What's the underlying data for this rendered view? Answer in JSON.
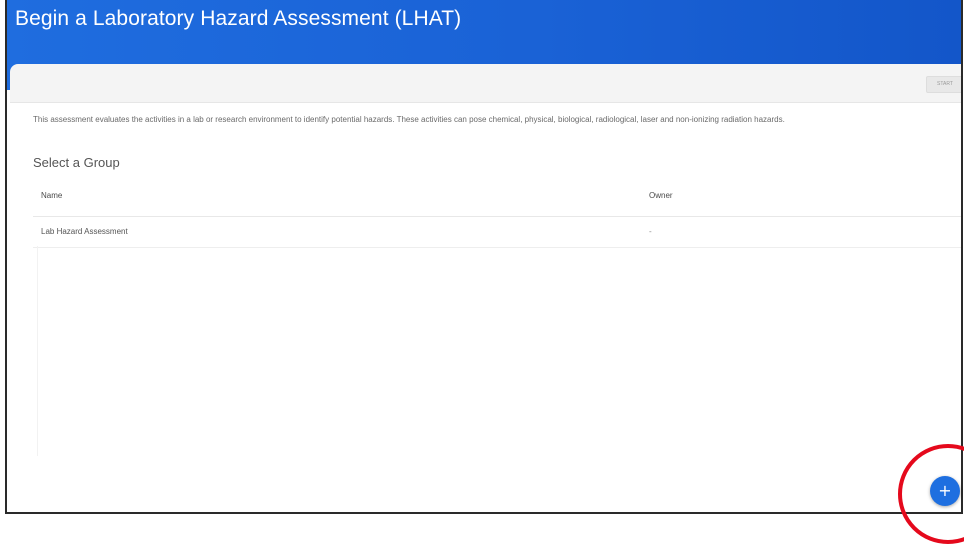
{
  "header": {
    "title": "Begin a Laboratory Hazard Assessment (LHAT)"
  },
  "toolbar": {
    "start_label": "START"
  },
  "main": {
    "description": "This assessment evaluates the activities in a lab or research environment to identify potential hazards. These activities can pose chemical, physical, biological, radiological, laser and non-ionizing radiation hazards.",
    "section_title": "Select a Group",
    "table": {
      "columns": [
        "Name",
        "Owner"
      ],
      "rows": [
        {
          "name": "Lab Hazard Assessment",
          "owner": "-"
        }
      ]
    }
  },
  "fab": {
    "icon": "plus-icon",
    "glyph": "+"
  },
  "colors": {
    "header": "#1a62d6",
    "fab": "#1e6fe0",
    "highlight": "#e5091c"
  }
}
